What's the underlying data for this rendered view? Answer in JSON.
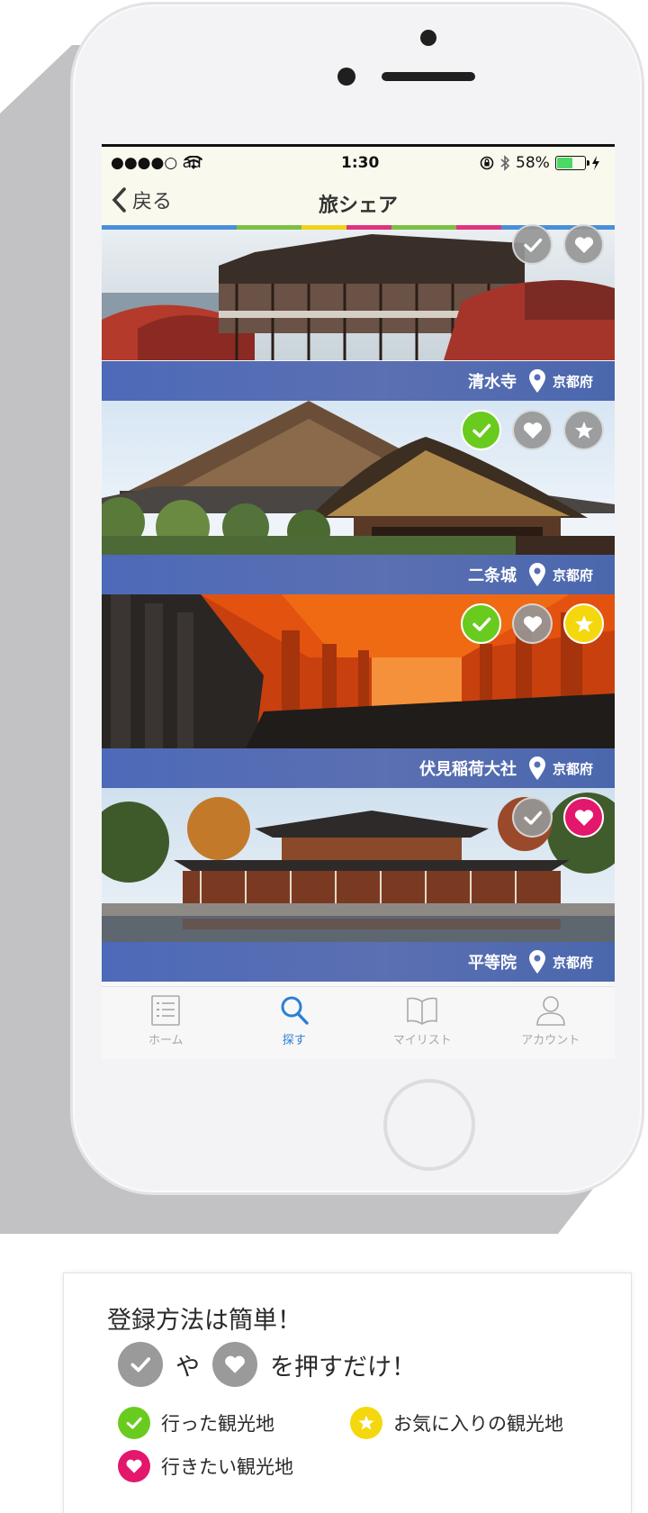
{
  "status_bar": {
    "carrier": "●●●●○ au",
    "time": "1:30",
    "battery": "58%",
    "battery_level": 0.58
  },
  "nav": {
    "back_label": "戻る",
    "title": "旅シェア"
  },
  "colors": {
    "rainbow": [
      "#4a90d9",
      "#4a90d9",
      "#7cc043",
      "#f2d21c",
      "#e2347e",
      "#7cc043",
      "#e2347e",
      "#4a90d9"
    ],
    "visited": "#6acb1f",
    "favorite": "#f4d80d",
    "want": "#e3176b",
    "inactive": "#9a9a9a"
  },
  "spots": [
    {
      "name": "清水寺",
      "prefecture": "京都府",
      "badges": [
        "check-grey",
        "heart-grey"
      ]
    },
    {
      "name": "二条城",
      "prefecture": "京都府",
      "badges": [
        "check-green",
        "heart-grey",
        "star-grey"
      ]
    },
    {
      "name": "伏見稲荷大社",
      "prefecture": "京都府",
      "badges": [
        "check-green",
        "heart-grey",
        "star-yellow"
      ]
    },
    {
      "name": "平等院",
      "prefecture": "京都府",
      "badges": [
        "check-grey",
        "heart-pink"
      ]
    }
  ],
  "tabs": [
    {
      "label": "ホーム",
      "icon": "list-icon",
      "active": false
    },
    {
      "label": "探す",
      "icon": "search-icon",
      "active": true
    },
    {
      "label": "マイリスト",
      "icon": "book-icon",
      "active": false
    },
    {
      "label": "アカウント",
      "icon": "person-icon",
      "active": false
    }
  ],
  "info": {
    "title": "登録方法は簡単！",
    "particle": "や",
    "action": "を押すだけ！",
    "legend": {
      "visited": "行った観光地",
      "favorite": "お気に入りの観光地",
      "want": "行きたい観光地"
    }
  }
}
